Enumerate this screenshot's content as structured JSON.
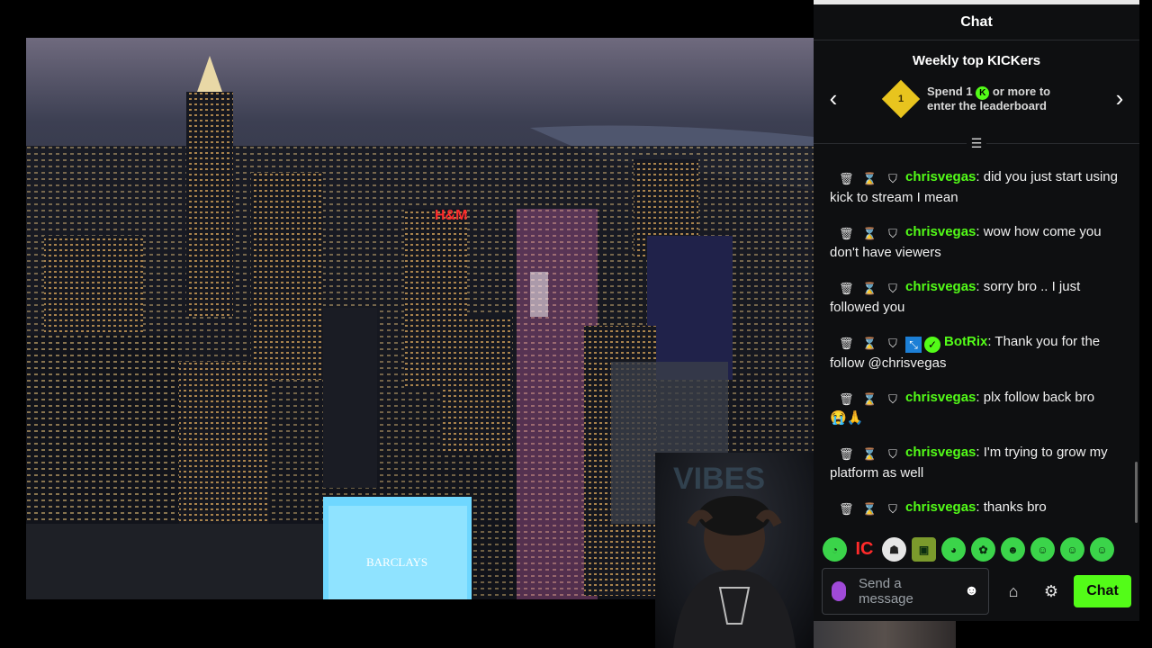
{
  "video": {
    "sign_hm": "H&M",
    "sign_barclays": "BARCLAYS"
  },
  "chat": {
    "title": "Chat",
    "leaderboard": {
      "title": "Weekly top KICKers",
      "badge_rank": "1",
      "coin": "K",
      "line1_prefix": "Spend 1",
      "line1_suffix": "or more to",
      "line2": "enter the leaderboard",
      "prev_icon": "chevron-left-icon",
      "next_icon": "chevron-right-icon"
    },
    "messages": [
      {
        "user": "chrisvegas",
        "text": ": did you just start using kick to stream I mean"
      },
      {
        "user": "chrisvegas",
        "text": ": wow how come you don't have viewers"
      },
      {
        "user": "chrisvegas",
        "text": ": sorry bro .. I just followed you"
      },
      {
        "user": "BotRix",
        "text": ": Thank you for the follow @chrisvegas",
        "bot": true
      },
      {
        "user": "chrisvegas",
        "text": ": plx follow back bro",
        "emoji": "😭🙏"
      },
      {
        "user": "chrisvegas",
        "text": ": I'm trying to grow my platform as well"
      },
      {
        "user": "chrisvegas",
        "text": ": thanks bro"
      }
    ],
    "emotes": [
      "emote-1",
      "emote-2",
      "emote-3",
      "emote-4",
      "emote-5",
      "emote-6",
      "emote-7",
      "emote-8",
      "emote-9",
      "emote-10"
    ],
    "input": {
      "placeholder": "Send a message",
      "send_label": "Chat"
    },
    "colors": {
      "accent": "#53fc18",
      "background": "#0e0f11"
    }
  }
}
